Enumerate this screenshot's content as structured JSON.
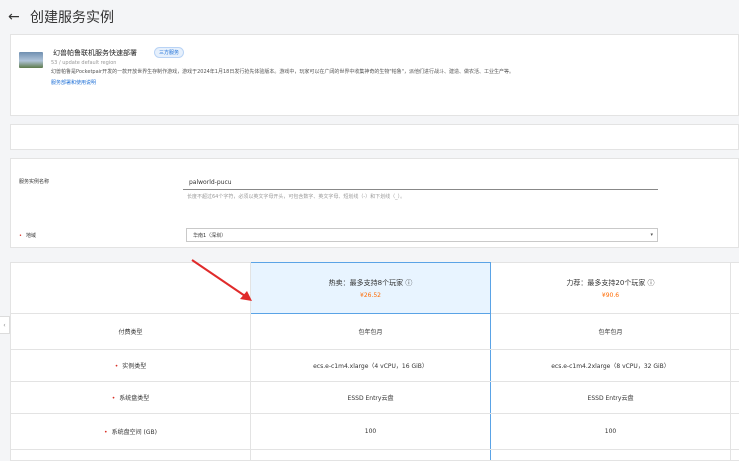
{
  "header": {
    "title": "创建服务实例"
  },
  "service": {
    "name": "幻兽帕鲁联机服务快速部署",
    "badge": "三方服务",
    "version": "53 / update default region",
    "description": "幻兽帕鲁是Pocketpair开发的一款开放世界生存制作游戏，游戏于2024年1月18日发行抢先体验版本。游戏中，玩家可以在广阔的世界中收集神奇的生物\"帕鲁\"，派他们进行战斗、建造、做农活、工业生产等。",
    "link": "服务部署和使用说明"
  },
  "form": {
    "instance_name_label": "服务实例名称",
    "instance_name_value": "palworld-pucu",
    "instance_name_hint": "长度不超过64个字符，必须以英文字母开头，可包含数字、英文字母、短划线（-）和下划线（_）。",
    "region_label": "地域",
    "region_value": "华南1（深圳）"
  },
  "plans": [
    {
      "title": "热卖：最多支持8个玩家 ⓘ",
      "price": "¥26.52"
    },
    {
      "title": "力荐：最多支持20个玩家 ⓘ",
      "price": "¥90.6"
    }
  ],
  "rows": [
    {
      "label": "付费类型",
      "required": false,
      "values": [
        "包年包月",
        "包年包月"
      ]
    },
    {
      "label": "实例类型",
      "required": true,
      "values": [
        "ecs.e-c1m4.xlarge（4 vCPU，16 GiB）",
        "ecs.e-c1m4.2xlarge（8 vCPU，32 GiB）"
      ]
    },
    {
      "label": "系统盘类型",
      "required": true,
      "values": [
        "ESSD Entry云盘",
        "ESSD Entry云盘"
      ]
    },
    {
      "label": "系统盘空间 (GB)",
      "required": true,
      "values": [
        "100",
        "100"
      ]
    }
  ],
  "colors": {
    "accent": "#1d6fd6",
    "price": "#ff6a00",
    "arrow": "#e02b2b",
    "selected_bg": "#e8f4ff"
  },
  "icons": {
    "back": "arrow-left-icon",
    "caret": "caret-down-icon",
    "side": "chevron-left-icon"
  }
}
